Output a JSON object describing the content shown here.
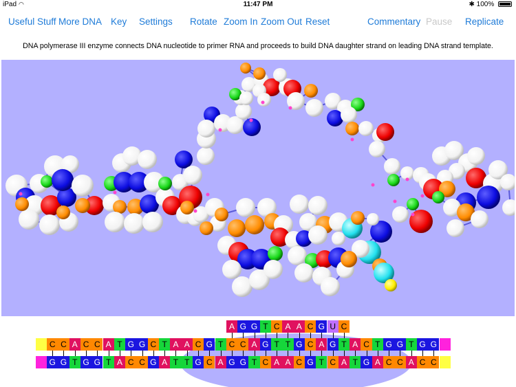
{
  "status": {
    "device": "iPad",
    "time": "11:47 PM",
    "battery": "100%"
  },
  "toolbar": {
    "useful_stuff": "Useful Stuff",
    "more_dna": "More DNA",
    "key": "Key",
    "settings": "Settings",
    "rotate": "Rotate",
    "zoom_in": "Zoom In",
    "zoom_out": "Zoom Out",
    "reset": "Reset",
    "commentary": "Commentary",
    "pause": "Pause",
    "replicate": "Replicate"
  },
  "description": "DNA polymerase III enzyme connects DNA nucleotide to primer RNA and proceeds to build DNA daughter strand on leading DNA strand template.",
  "colors": {
    "viewport_bg": "#b3b0ff",
    "A": "#e0115f",
    "C": "#ff8800",
    "G": "#1b16e0",
    "T": "#16d63b",
    "U": "#c070ff",
    "end_yellow": "#ffff44",
    "end_magenta": "#ff22dd",
    "link_blue": "#1e7bd8"
  },
  "sequence": {
    "primer_rna": [
      "A",
      "G",
      "G",
      "T",
      "C",
      "A",
      "A",
      "C",
      "G",
      "U",
      "C"
    ],
    "top_strand": [
      "C",
      "C",
      "A",
      "C",
      "C",
      "A",
      "T",
      "G",
      "G",
      "C",
      "T",
      "A",
      "A",
      "C",
      "G",
      "T",
      "C",
      "C",
      "A",
      "G",
      "T",
      "T",
      "G",
      "C",
      "A",
      "G",
      "T",
      "A",
      "C",
      "T",
      "G",
      "G",
      "T",
      "G",
      "G"
    ],
    "bottom_strand": [
      "G",
      "G",
      "T",
      "G",
      "G",
      "T",
      "A",
      "C",
      "C",
      "G",
      "A",
      "T",
      "T",
      "G",
      "C",
      "A",
      "G",
      "G",
      "T",
      "C",
      "A",
      "A",
      "C",
      "G",
      "T",
      "C",
      "A",
      "T",
      "G",
      "A",
      "C",
      "C",
      "A",
      "C",
      "C"
    ]
  }
}
